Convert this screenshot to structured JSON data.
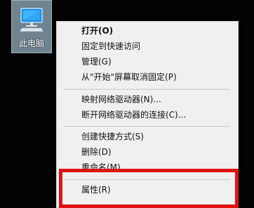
{
  "desktop": {
    "icon": {
      "name": "this-pc-icon",
      "label": "此电脑"
    }
  },
  "context_menu": {
    "items": [
      {
        "label": "打开(O)",
        "bold": true
      },
      {
        "label": "固定到快速访问"
      },
      {
        "label": "管理(G)"
      },
      {
        "label": "从\"开始\"屏幕取消固定(P)"
      },
      {
        "label": "映射网络驱动器(N)..."
      },
      {
        "label": "断开网络驱动器的连接(C)..."
      },
      {
        "label": "创建快捷方式(S)"
      },
      {
        "label": "删除(D)"
      },
      {
        "label": "重命名(M)"
      },
      {
        "label": "属性(R)"
      }
    ]
  },
  "colors": {
    "highlight": "#e01212",
    "menu_background": "#f0f0f0",
    "desktop_background": "#030303"
  }
}
